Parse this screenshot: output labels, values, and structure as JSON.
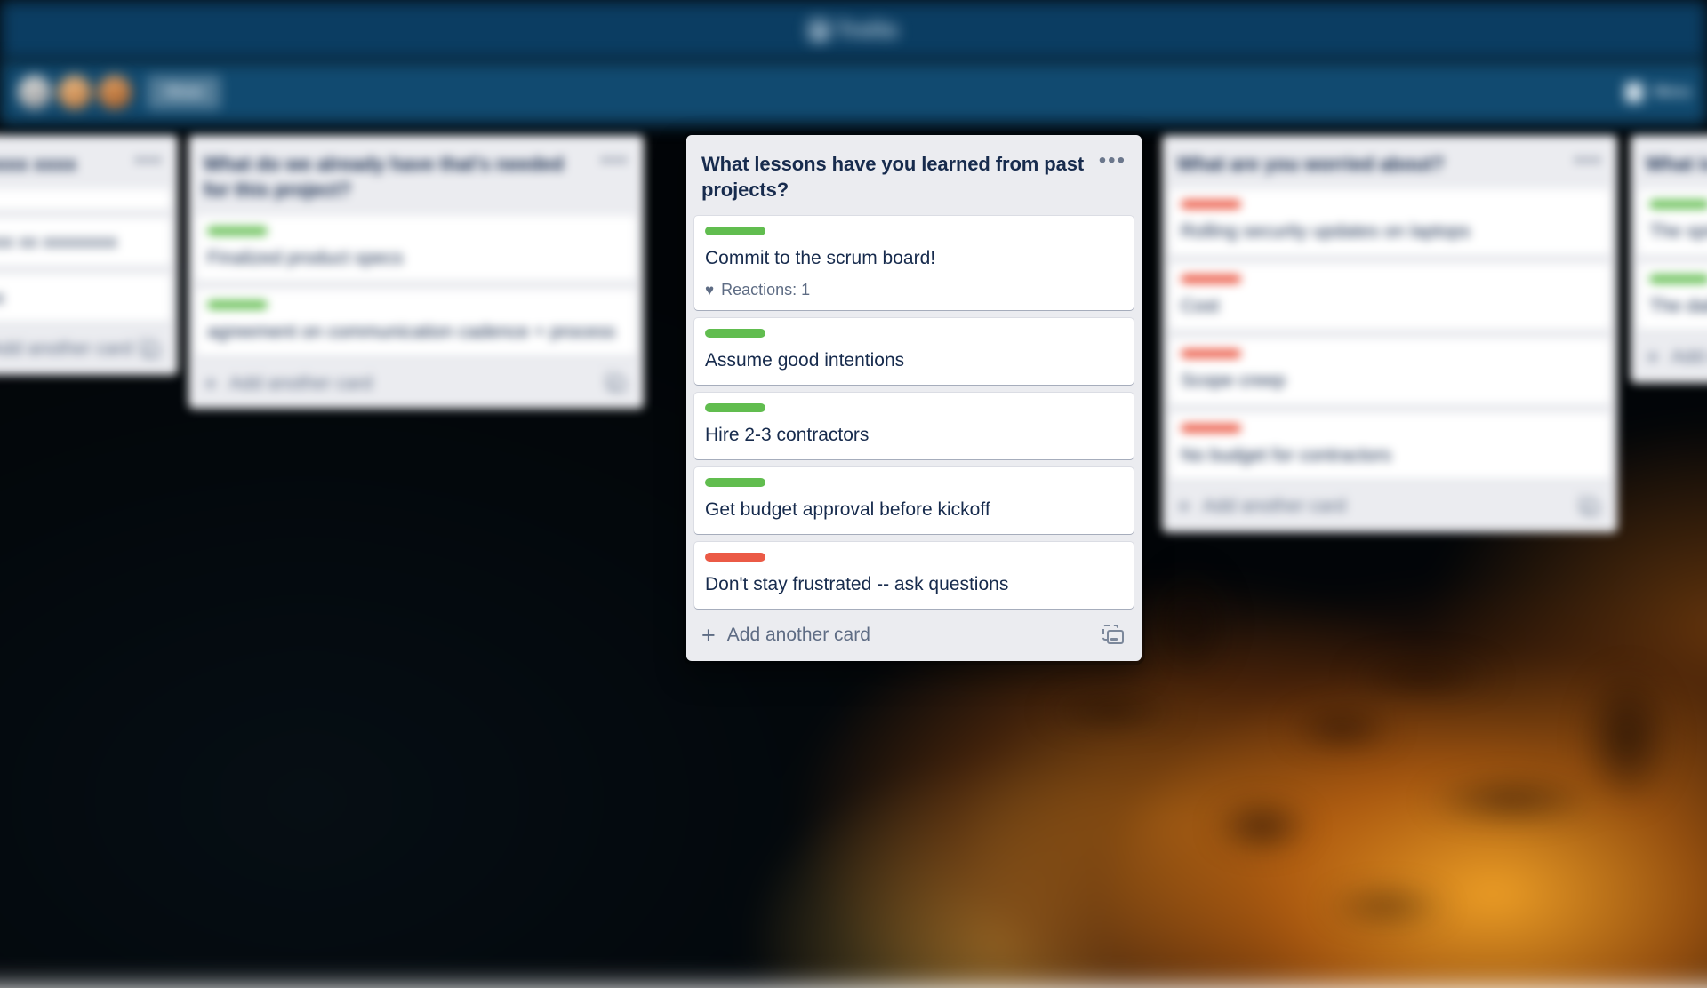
{
  "app": {
    "name": "Trello",
    "logo_icon": "trello-logo-icon"
  },
  "board_bar": {
    "members_label": "",
    "button_label": "Show",
    "right_label": "Menu",
    "avatars": [
      "avatar-1",
      "avatar-2",
      "avatar-3"
    ]
  },
  "colors": {
    "label_green": "#61bd4f",
    "label_red": "#eb5a46",
    "list_background": "#ebecf0",
    "card_background": "#ffffff",
    "text_primary": "#172b4d",
    "text_muted": "#5e6c84",
    "top_bar": "#0b3d62",
    "board_bar": "#114a70"
  },
  "icons": {
    "list_menu": "ellipsis-horizontal-icon",
    "add_card_plus": "plus-icon",
    "card_template": "card-template-icon",
    "reaction_heart": "heart-icon"
  },
  "lists": [
    {
      "id": "list-1",
      "title": "xxxxxx xxxx",
      "focused": false,
      "menu": "•••",
      "footer_label": "Add another card",
      "cards": [
        {
          "title": "",
          "label": "none",
          "badges": ""
        },
        {
          "title": "xxxxx xx xxxxxxxx",
          "label": "none",
          "badges": ""
        },
        {
          "title": "xxxx",
          "label": "none",
          "badges": ""
        }
      ]
    },
    {
      "id": "list-2",
      "title": "What do we already have that's needed for this project?",
      "focused": false,
      "menu": "•••",
      "footer_label": "Add another card",
      "cards": [
        {
          "title": "Finalized product specs",
          "label": "green",
          "badges": ""
        },
        {
          "title": "agreement on communication cadence + process",
          "label": "green",
          "badges": ""
        }
      ]
    },
    {
      "id": "list-3",
      "title": "What lessons have you learned from past projects?",
      "focused": true,
      "menu": "•••",
      "footer_label": "Add another card",
      "cards": [
        {
          "title": "Commit to the scrum board!",
          "label": "green",
          "badges": "Reactions: 1"
        },
        {
          "title": "Assume good intentions",
          "label": "green",
          "badges": ""
        },
        {
          "title": "Hire 2-3 contractors",
          "label": "green",
          "badges": ""
        },
        {
          "title": "Get budget approval before kickoff",
          "label": "green",
          "badges": ""
        },
        {
          "title": "Don't stay frustrated -- ask questions",
          "label": "red",
          "badges": ""
        }
      ]
    },
    {
      "id": "list-4",
      "title": "What are you worried about?",
      "focused": false,
      "menu": "•••",
      "footer_label": "Add another card",
      "cards": [
        {
          "title": "Rolling security updates on laptops",
          "label": "red",
          "badges": ""
        },
        {
          "title": "Cost",
          "label": "red",
          "badges": ""
        },
        {
          "title": "Scope creep",
          "label": "red",
          "badges": ""
        },
        {
          "title": "No budget for contractors",
          "label": "red",
          "badges": ""
        }
      ]
    },
    {
      "id": "list-5",
      "title": "What is working well?",
      "focused": false,
      "menu": "•••",
      "footer_label": "Add another card",
      "cards": [
        {
          "title": "The sprint cadence",
          "label": "green",
          "badges": ""
        },
        {
          "title": "The daily standups",
          "label": "green",
          "badges": ""
        }
      ]
    }
  ]
}
